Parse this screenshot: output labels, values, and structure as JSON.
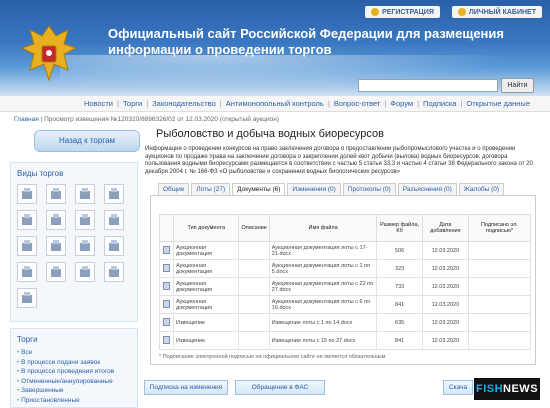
{
  "header": {
    "registration": "РЕГИСТРАЦИЯ",
    "cabinet": "ЛИЧНЫЙ КАБИНЕТ",
    "title": "Официальный сайт Российской Федерации для размещения информации о проведении торгов",
    "search_button": "Найти"
  },
  "nav": [
    "Новости",
    "Торги",
    "Законодательство",
    "Антимонопольный контроль",
    "Вопрос-ответ",
    "Форум",
    "Подписка",
    "Открытые данные"
  ],
  "breadcrumb": {
    "home": "Главная",
    "current": "Просмотр извещения №120320/8896326/02 от 12.03.2020 (открытый аукцион)"
  },
  "sidebar": {
    "back_button": "Назад к торгам",
    "types_title": "Виды торгов",
    "icons": [
      "building-icon",
      "construction-icon",
      "factory-icon",
      "oil-rig-icon",
      "forest-icon",
      "bridge-icon",
      "car-icon",
      "tower-icon",
      "house-icon",
      "fish-icon",
      "truck-icon",
      "crane-icon",
      "wave-icon",
      "chart-icon",
      "machine-icon",
      "power-icon",
      "antenna-icon"
    ],
    "bids_title": "Торги",
    "bids": [
      "Все",
      "В процессе подачи заявок",
      "В процессе проведения итогов",
      "Отмененные/аннулированные",
      "Завершенные",
      "Приостановленные"
    ]
  },
  "main": {
    "title": "Рыболовство и добыча водных биоресурсов",
    "description": "Информация о проведении конкурсов на право заключения договора о предоставлении рыбопромыслового участка и о проведении аукционов по продаже права на заключение договора о закреплении долей квот добычи (вылова) водных биоресурсов, договора пользования водными биоресурсами размещается в соответствии с частью 5 статьи 33.3 и частью 4 статьи 38 Федерального закона от 20 декабря 2004 г. № 166-ФЗ «О рыболовстве и сохранении водных биологических ресурсов»",
    "tabs": [
      "Общие",
      "Лоты (27)",
      "Документы (6)",
      "Изменения (0)",
      "Протоколы (0)",
      "Разъяснения (0)",
      "Жалобы (0)"
    ],
    "active_tab": 2,
    "table": {
      "headers": [
        "Тип документа",
        "Описание",
        "Имя файла",
        "Размер файла, Кб",
        "Дата добавления",
        "Подписано эл. подписью*"
      ],
      "rows": [
        [
          "Аукционная документация",
          "",
          "Аукционная документация лоты с 17-21.docx",
          "506",
          "12.03.2020",
          ""
        ],
        [
          "Аукционная документация",
          "",
          "Аукционная документация лоты с 1 по 5.docx",
          "323",
          "12.03.2020",
          ""
        ],
        [
          "Аукционная документация",
          "",
          "Аукционная документация лоты с 22 по 27.docx",
          "733",
          "12.03.2020",
          ""
        ],
        [
          "Аукционная документация",
          "",
          "Аукционная документация лоты с 6 по 16.docx",
          "841",
          "12.03.2020",
          ""
        ],
        [
          "Извещение",
          "",
          "Извещение лоты с 1 по 14.docx",
          "635",
          "12.03.2020",
          ""
        ],
        [
          "Извещение",
          "",
          "Извещение лоты с 15 по 27.docx",
          "841",
          "12.03.2020",
          ""
        ]
      ]
    },
    "note": "* Подписание электронной подписью на официальном сайте не является обязательным",
    "buttons": {
      "subscribe": "Подписка на изменения",
      "fas": "Обращение в ФАС",
      "download": "Скача"
    }
  },
  "watermark": {
    "left": "FISH",
    "right": "NEWS"
  }
}
